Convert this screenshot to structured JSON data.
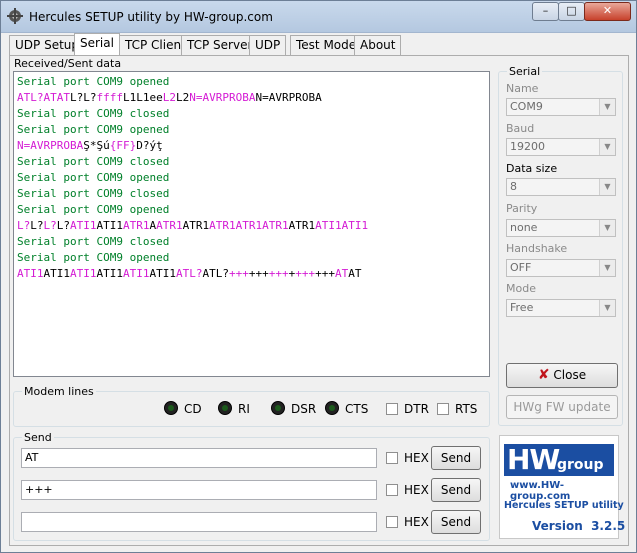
{
  "window": {
    "title": "Hercules SETUP utility by HW-group.com",
    "controls": {
      "minimize": "–",
      "maximize": "□",
      "close": "✕"
    }
  },
  "tabs": [
    "UDP Setup",
    "Serial",
    "TCP Client",
    "TCP Server",
    "UDP",
    "Test Mode",
    "About"
  ],
  "active_tab": "Serial",
  "received": {
    "label": "Received/Sent data",
    "lines": [
      [
        {
          "t": "Serial port COM9 opened",
          "c": "green"
        }
      ],
      [
        {
          "t": "ATL?ATAT",
          "c": "pink"
        },
        {
          "t": "L?L?",
          "c": "black"
        },
        {
          "t": "ffff",
          "c": "pink"
        },
        {
          "t": "L1L1ee",
          "c": "black"
        },
        {
          "t": "L2",
          "c": "pink"
        },
        {
          "t": "L2",
          "c": "black"
        },
        {
          "t": "N=AVRPROBA",
          "c": "pink"
        },
        {
          "t": "N=AVRPROBA",
          "c": "black"
        }
      ],
      [
        {
          "t": "Serial port COM9 closed",
          "c": "green"
        }
      ],
      [
        {
          "t": "Serial port COM9 opened",
          "c": "green"
        }
      ],
      [
        {
          "t": "N=AVRPROBA",
          "c": "pink"
        },
        {
          "t": "Ş*Şú",
          "c": "black"
        },
        {
          "t": "{FF}",
          "c": "pink"
        },
        {
          "t": "D?",
          "c": "black"
        },
        {
          "t": "ýţ",
          "c": "black"
        }
      ],
      [
        {
          "t": "Serial port COM9 closed",
          "c": "green"
        }
      ],
      [
        {
          "t": "Serial port COM9 opened",
          "c": "green"
        }
      ],
      [
        {
          "t": "Serial port COM9 closed",
          "c": "green"
        }
      ],
      [
        {
          "t": "Serial port COM9 opened",
          "c": "green"
        }
      ],
      [
        {
          "t": "L?",
          "c": "pink"
        },
        {
          "t": "L?",
          "c": "black"
        },
        {
          "t": "L?",
          "c": "pink"
        },
        {
          "t": "L?",
          "c": "black"
        },
        {
          "t": "ATI1",
          "c": "pink"
        },
        {
          "t": "ATI1",
          "c": "black"
        },
        {
          "t": "ATR1",
          "c": "pink"
        },
        {
          "t": "A",
          "c": "black"
        },
        {
          "t": "ATR1",
          "c": "pink"
        },
        {
          "t": "ATR1",
          "c": "black"
        },
        {
          "t": "ATR1ATR1ATR1",
          "c": "pink"
        },
        {
          "t": "ATR1",
          "c": "black"
        },
        {
          "t": "ATI1ATI1",
          "c": "pink"
        }
      ],
      [
        {
          "t": "Serial port COM9 closed",
          "c": "green"
        }
      ],
      [
        {
          "t": "Serial port COM9 opened",
          "c": "green"
        }
      ],
      [
        {
          "t": "ATI1",
          "c": "pink"
        },
        {
          "t": "ATI1",
          "c": "black"
        },
        {
          "t": "ATI1",
          "c": "pink"
        },
        {
          "t": "ATI1",
          "c": "black"
        },
        {
          "t": "ATI1",
          "c": "pink"
        },
        {
          "t": "ATI1",
          "c": "black"
        },
        {
          "t": "ATL?",
          "c": "pink"
        },
        {
          "t": "ATL?",
          "c": "black"
        },
        {
          "t": "+++",
          "c": "pink"
        },
        {
          "t": "+++",
          "c": "black"
        },
        {
          "t": "+++",
          "c": "pink"
        },
        {
          "t": "+",
          "c": "black"
        },
        {
          "t": "+++",
          "c": "pink"
        },
        {
          "t": "+++",
          "c": "black"
        },
        {
          "t": "AT",
          "c": "pink"
        },
        {
          "t": "AT",
          "c": "black"
        }
      ]
    ]
  },
  "modem": {
    "title": "Modem lines",
    "leds": [
      "CD",
      "RI",
      "DSR",
      "CTS"
    ],
    "checks": [
      "DTR",
      "RTS"
    ]
  },
  "serial": {
    "title": "Serial",
    "fields": [
      {
        "label": "Name",
        "value": "COM9",
        "enabled": false
      },
      {
        "label": "Baud",
        "value": "19200",
        "enabled": false
      },
      {
        "label": "Data size",
        "value": "8",
        "enabled": true
      },
      {
        "label": "Parity",
        "value": "none",
        "enabled": false
      },
      {
        "label": "Handshake",
        "value": "OFF",
        "enabled": false
      },
      {
        "label": "Mode",
        "value": "Free",
        "enabled": false
      }
    ],
    "close_button": "Close",
    "fw_button": "HWg FW update"
  },
  "send": {
    "title": "Send",
    "rows": [
      {
        "value": "AT",
        "hex_label": "HEX",
        "button": "Send"
      },
      {
        "value": "+++",
        "hex_label": "HEX",
        "button": "Send"
      },
      {
        "value": "",
        "hex_label": "HEX",
        "button": "Send"
      }
    ]
  },
  "logo": {
    "brand": "HW",
    "group": "group",
    "url": "www.HW-group.com",
    "product": "Hercules SETUP utility",
    "version": "Version  3.2.5"
  },
  "colors": {
    "green": "#00802a",
    "pink": "#d41bd4",
    "brand_blue": "#1b4ea2"
  }
}
